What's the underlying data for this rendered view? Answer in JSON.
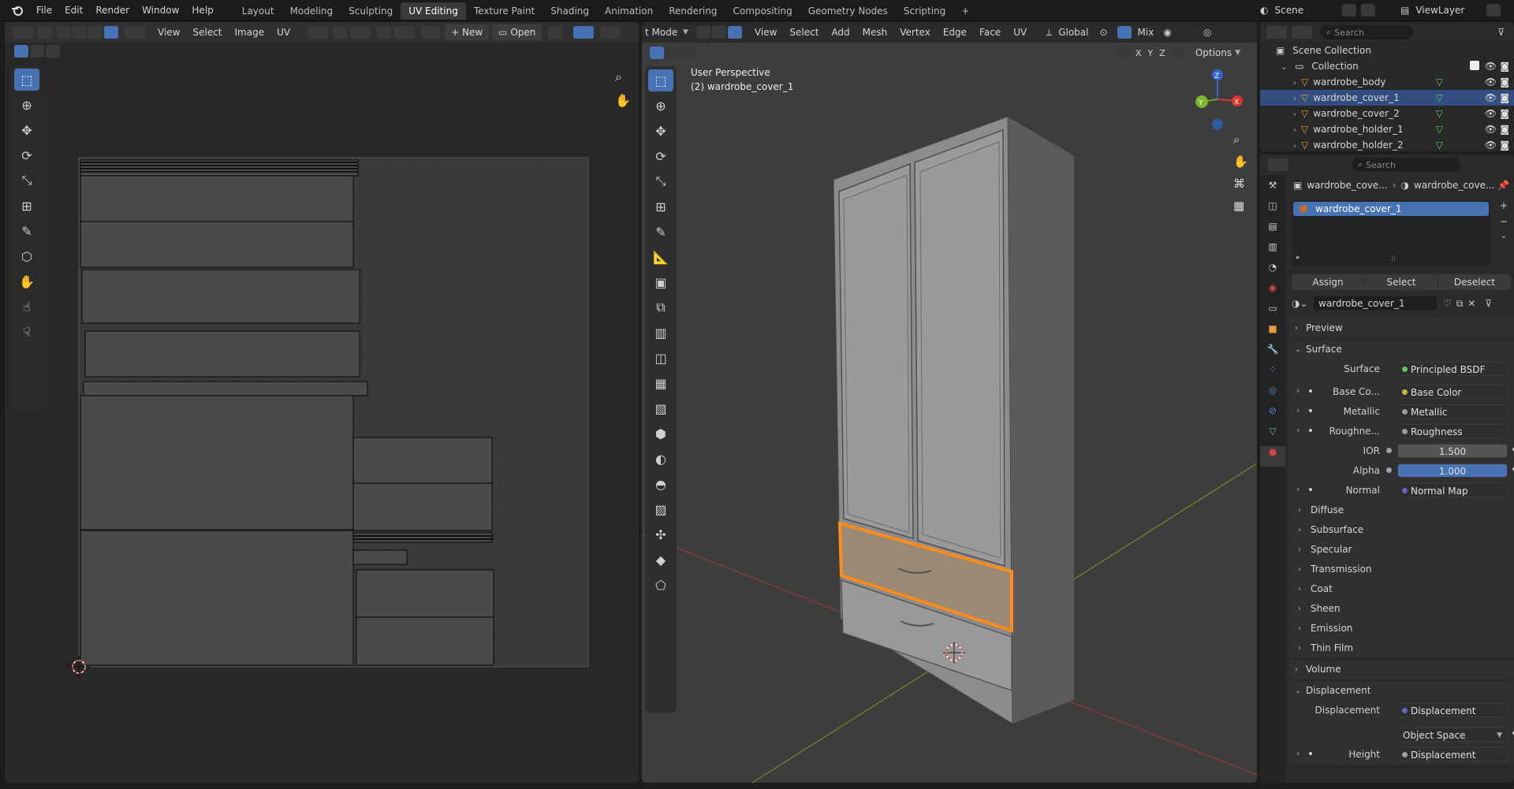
{
  "topbar": {
    "menus": [
      "File",
      "Edit",
      "Render",
      "Window",
      "Help"
    ],
    "workspaces": [
      "Layout",
      "Modeling",
      "Sculpting",
      "UV Editing",
      "Texture Paint",
      "Shading",
      "Animation",
      "Rendering",
      "Compositing",
      "Geometry Nodes",
      "Scripting"
    ],
    "active_workspace": "UV Editing",
    "add_tab": "+",
    "scene": "Scene",
    "view_layer": "ViewLayer"
  },
  "uv_editor": {
    "menus": [
      "View",
      "Select",
      "Image",
      "UV"
    ],
    "new_label": "New",
    "open_label": "Open"
  },
  "viewport": {
    "mode_label": "t Mode",
    "menus": [
      "View",
      "Select",
      "Add",
      "Mesh",
      "Vertex",
      "Edge",
      "Face",
      "UV"
    ],
    "orientation": "Global",
    "shading": "Mix",
    "options_label": "Options",
    "axes": [
      "X",
      "Y",
      "Z"
    ],
    "overlay_title": "User Perspective",
    "overlay_object": "(2) wardrobe_cover_1",
    "gizmo_x": "X",
    "gizmo_y": "Y",
    "gizmo_z": "Z"
  },
  "outliner": {
    "search_placeholder": "Search",
    "scene_collection": "Scene Collection",
    "collection": "Collection",
    "items": [
      {
        "name": "wardrobe_body",
        "selected": false
      },
      {
        "name": "wardrobe_cover_1",
        "selected": true
      },
      {
        "name": "wardrobe_cover_2",
        "selected": false
      },
      {
        "name": "wardrobe_holder_1",
        "selected": false
      },
      {
        "name": "wardrobe_holder_2",
        "selected": false
      }
    ]
  },
  "properties": {
    "search_placeholder": "Search",
    "breadcrumb_object": "wardrobe_cove...",
    "breadcrumb_material": "wardrobe_cove...",
    "slot_name": "wardrobe_cover_1",
    "assign_label": "Assign",
    "select_label": "Select",
    "deselect_label": "Deselect",
    "material_name": "wardrobe_cover_1",
    "preview_label": "Preview",
    "surface_panel": "Surface",
    "surface_label": "Surface",
    "surface_value": "Principled BSDF",
    "inputs": [
      {
        "label": "Base Co...",
        "value": "Base Color",
        "dot": "#c8b93a",
        "expandable": true
      },
      {
        "label": "Metallic",
        "value": "Metallic",
        "dot": "#9a9a9a",
        "expandable": true
      },
      {
        "label": "Roughne...",
        "value": "Roughness",
        "dot": "#9a9a9a",
        "expandable": true
      }
    ],
    "ior_label": "IOR",
    "ior_value": "1.500",
    "alpha_label": "Alpha",
    "alpha_value": "1.000",
    "normal_label": "Normal",
    "normal_value": "Normal Map",
    "subpanels": [
      "Diffuse",
      "Subsurface",
      "Specular",
      "Transmission",
      "Coat",
      "Sheen",
      "Emission",
      "Thin Film"
    ],
    "volume_panel": "Volume",
    "displacement_panel": "Displacement",
    "displacement_label": "Displacement",
    "displacement_value": "Displacement",
    "space_value": "Object Space",
    "height_label": "Height",
    "height_value": "Displacement"
  },
  "colors": {
    "accent": "#4772b3",
    "selection_orange": "#ff8c1a",
    "vector_dot": "#6363c7",
    "color_dot": "#c8b93a",
    "float_dot": "#a1a1a1",
    "shader_dot": "#63c763"
  }
}
